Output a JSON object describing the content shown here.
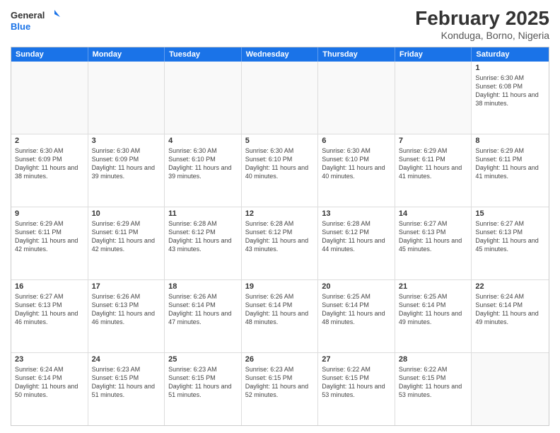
{
  "logo": {
    "line1": "General",
    "line2": "Blue"
  },
  "title": "February 2025",
  "subtitle": "Konduga, Borno, Nigeria",
  "days": [
    "Sunday",
    "Monday",
    "Tuesday",
    "Wednesday",
    "Thursday",
    "Friday",
    "Saturday"
  ],
  "weeks": [
    [
      {
        "day": "",
        "info": ""
      },
      {
        "day": "",
        "info": ""
      },
      {
        "day": "",
        "info": ""
      },
      {
        "day": "",
        "info": ""
      },
      {
        "day": "",
        "info": ""
      },
      {
        "day": "",
        "info": ""
      },
      {
        "day": "1",
        "info": "Sunrise: 6:30 AM\nSunset: 6:08 PM\nDaylight: 11 hours and 38 minutes."
      }
    ],
    [
      {
        "day": "2",
        "info": "Sunrise: 6:30 AM\nSunset: 6:09 PM\nDaylight: 11 hours and 38 minutes."
      },
      {
        "day": "3",
        "info": "Sunrise: 6:30 AM\nSunset: 6:09 PM\nDaylight: 11 hours and 39 minutes."
      },
      {
        "day": "4",
        "info": "Sunrise: 6:30 AM\nSunset: 6:10 PM\nDaylight: 11 hours and 39 minutes."
      },
      {
        "day": "5",
        "info": "Sunrise: 6:30 AM\nSunset: 6:10 PM\nDaylight: 11 hours and 40 minutes."
      },
      {
        "day": "6",
        "info": "Sunrise: 6:30 AM\nSunset: 6:10 PM\nDaylight: 11 hours and 40 minutes."
      },
      {
        "day": "7",
        "info": "Sunrise: 6:29 AM\nSunset: 6:11 PM\nDaylight: 11 hours and 41 minutes."
      },
      {
        "day": "8",
        "info": "Sunrise: 6:29 AM\nSunset: 6:11 PM\nDaylight: 11 hours and 41 minutes."
      }
    ],
    [
      {
        "day": "9",
        "info": "Sunrise: 6:29 AM\nSunset: 6:11 PM\nDaylight: 11 hours and 42 minutes."
      },
      {
        "day": "10",
        "info": "Sunrise: 6:29 AM\nSunset: 6:11 PM\nDaylight: 11 hours and 42 minutes."
      },
      {
        "day": "11",
        "info": "Sunrise: 6:28 AM\nSunset: 6:12 PM\nDaylight: 11 hours and 43 minutes."
      },
      {
        "day": "12",
        "info": "Sunrise: 6:28 AM\nSunset: 6:12 PM\nDaylight: 11 hours and 43 minutes."
      },
      {
        "day": "13",
        "info": "Sunrise: 6:28 AM\nSunset: 6:12 PM\nDaylight: 11 hours and 44 minutes."
      },
      {
        "day": "14",
        "info": "Sunrise: 6:27 AM\nSunset: 6:13 PM\nDaylight: 11 hours and 45 minutes."
      },
      {
        "day": "15",
        "info": "Sunrise: 6:27 AM\nSunset: 6:13 PM\nDaylight: 11 hours and 45 minutes."
      }
    ],
    [
      {
        "day": "16",
        "info": "Sunrise: 6:27 AM\nSunset: 6:13 PM\nDaylight: 11 hours and 46 minutes."
      },
      {
        "day": "17",
        "info": "Sunrise: 6:26 AM\nSunset: 6:13 PM\nDaylight: 11 hours and 46 minutes."
      },
      {
        "day": "18",
        "info": "Sunrise: 6:26 AM\nSunset: 6:14 PM\nDaylight: 11 hours and 47 minutes."
      },
      {
        "day": "19",
        "info": "Sunrise: 6:26 AM\nSunset: 6:14 PM\nDaylight: 11 hours and 48 minutes."
      },
      {
        "day": "20",
        "info": "Sunrise: 6:25 AM\nSunset: 6:14 PM\nDaylight: 11 hours and 48 minutes."
      },
      {
        "day": "21",
        "info": "Sunrise: 6:25 AM\nSunset: 6:14 PM\nDaylight: 11 hours and 49 minutes."
      },
      {
        "day": "22",
        "info": "Sunrise: 6:24 AM\nSunset: 6:14 PM\nDaylight: 11 hours and 49 minutes."
      }
    ],
    [
      {
        "day": "23",
        "info": "Sunrise: 6:24 AM\nSunset: 6:14 PM\nDaylight: 11 hours and 50 minutes."
      },
      {
        "day": "24",
        "info": "Sunrise: 6:23 AM\nSunset: 6:15 PM\nDaylight: 11 hours and 51 minutes."
      },
      {
        "day": "25",
        "info": "Sunrise: 6:23 AM\nSunset: 6:15 PM\nDaylight: 11 hours and 51 minutes."
      },
      {
        "day": "26",
        "info": "Sunrise: 6:23 AM\nSunset: 6:15 PM\nDaylight: 11 hours and 52 minutes."
      },
      {
        "day": "27",
        "info": "Sunrise: 6:22 AM\nSunset: 6:15 PM\nDaylight: 11 hours and 53 minutes."
      },
      {
        "day": "28",
        "info": "Sunrise: 6:22 AM\nSunset: 6:15 PM\nDaylight: 11 hours and 53 minutes."
      },
      {
        "day": "",
        "info": ""
      }
    ]
  ],
  "colors": {
    "header_bg": "#1a73e8",
    "header_text": "#ffffff",
    "border": "#cccccc"
  }
}
